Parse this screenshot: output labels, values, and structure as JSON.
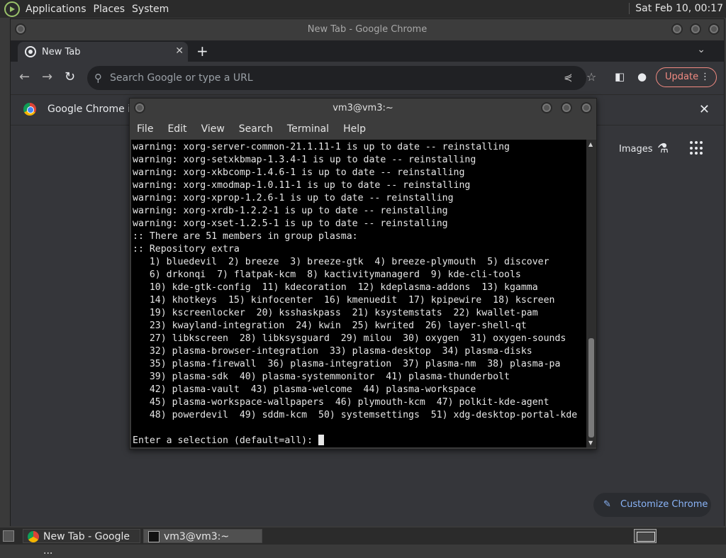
{
  "top_panel": {
    "menus": [
      "Applications",
      "Places",
      "System"
    ],
    "clock": "Sat Feb 10, 00:17"
  },
  "chrome": {
    "window_title": "New Tab - Google Chrome",
    "tab_title": "New Tab",
    "omnibox_placeholder": "Search Google or type a URL",
    "update_label": "Update",
    "infobar_text": "Google Chrome isn",
    "images_link": "Images",
    "customize_label": "Customize Chrome"
  },
  "terminal": {
    "window_title": "vm3@vm3:~",
    "menus": [
      "File",
      "Edit",
      "View",
      "Search",
      "Terminal",
      "Help"
    ],
    "lines": [
      "warning: xorg-server-common-21.1.11-1 is up to date -- reinstalling",
      "warning: xorg-setxkbmap-1.3.4-1 is up to date -- reinstalling",
      "warning: xorg-xkbcomp-1.4.6-1 is up to date -- reinstalling",
      "warning: xorg-xmodmap-1.0.11-1 is up to date -- reinstalling",
      "warning: xorg-xprop-1.2.6-1 is up to date -- reinstalling",
      "warning: xorg-xrdb-1.2.2-1 is up to date -- reinstalling",
      "warning: xorg-xset-1.2.5-1 is up to date -- reinstalling",
      ":: There are 51 members in group plasma:",
      ":: Repository extra",
      "   1) bluedevil  2) breeze  3) breeze-gtk  4) breeze-plymouth  5) discover",
      "   6) drkonqi  7) flatpak-kcm  8) kactivitymanagerd  9) kde-cli-tools",
      "   10) kde-gtk-config  11) kdecoration  12) kdeplasma-addons  13) kgamma",
      "   14) khotkeys  15) kinfocenter  16) kmenuedit  17) kpipewire  18) kscreen",
      "   19) kscreenlocker  20) ksshaskpass  21) ksystemstats  22) kwallet-pam",
      "   23) kwayland-integration  24) kwin  25) kwrited  26) layer-shell-qt",
      "   27) libkscreen  28) libksysguard  29) milou  30) oxygen  31) oxygen-sounds",
      "   32) plasma-browser-integration  33) plasma-desktop  34) plasma-disks",
      "   35) plasma-firewall  36) plasma-integration  37) plasma-nm  38) plasma-pa",
      "   39) plasma-sdk  40) plasma-systemmonitor  41) plasma-thunderbolt",
      "   42) plasma-vault  43) plasma-welcome  44) plasma-workspace",
      "   45) plasma-workspace-wallpapers  46) plymouth-kcm  47) polkit-kde-agent",
      "   48) powerdevil  49) sddm-kcm  50) systemsettings  51) xdg-desktop-portal-kde",
      ""
    ],
    "prompt": "Enter a selection (default=all): "
  },
  "taskbar": {
    "tasks": [
      "New Tab - Google ...",
      "vm3@vm3:~"
    ]
  }
}
